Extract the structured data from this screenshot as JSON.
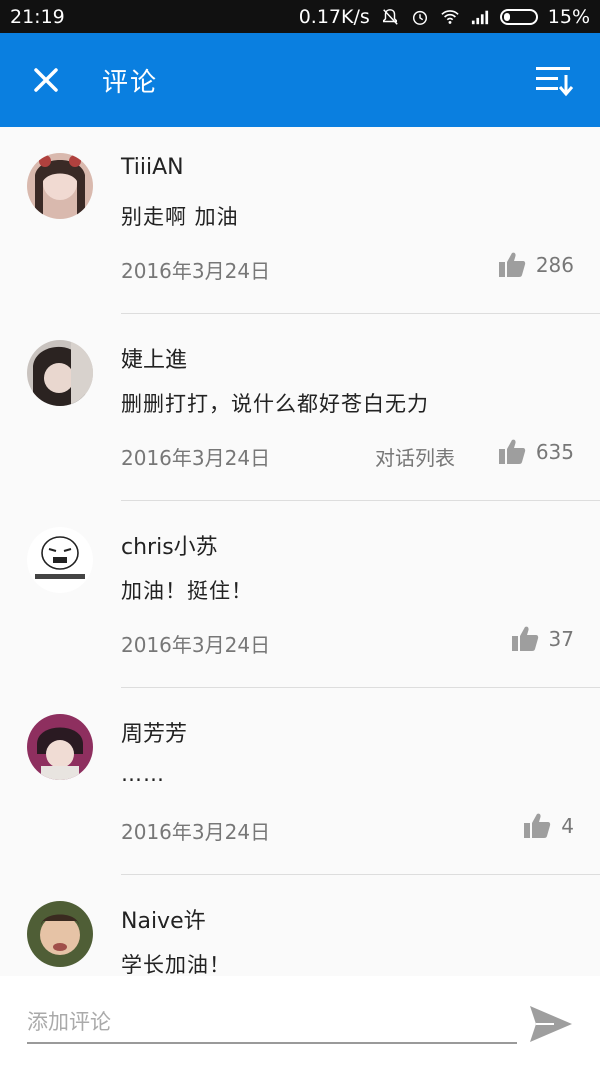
{
  "status_bar": {
    "time": "21:19",
    "network_speed": "0.17K/s",
    "battery": "15%"
  },
  "app_bar": {
    "title": "评论"
  },
  "comments": [
    {
      "name": "TiiiAN",
      "text": "别走啊 加油",
      "date": "2016年3月24日",
      "dialog": "",
      "likes": "286"
    },
    {
      "name": "婕上進",
      "text": "删删打打，说什么都好苍白无力",
      "date": "2016年3月24日",
      "dialog": "对话列表",
      "likes": "635"
    },
    {
      "name": "chris小苏",
      "text": "加油！挺住！",
      "date": "2016年3月24日",
      "dialog": "",
      "likes": "37"
    },
    {
      "name": "周芳芳",
      "text": "……",
      "date": "2016年3月24日",
      "dialog": "",
      "likes": "4"
    },
    {
      "name": "Naive许",
      "text": "学长加油！",
      "date": "",
      "dialog": "",
      "likes": ""
    }
  ],
  "avatar_colors": [
    "#c9a7a0",
    "#8a7f7a",
    "#f2f2f2",
    "#9b3a6a",
    "#5a6a3a"
  ],
  "comment_input": {
    "placeholder": "添加评论"
  },
  "colors": {
    "accent": "#0a7fe0",
    "status_bar": "#111111"
  },
  "icons": {
    "close": "close-icon",
    "sort": "sort-icon",
    "like": "thumbs-up-icon",
    "send": "send-icon"
  }
}
